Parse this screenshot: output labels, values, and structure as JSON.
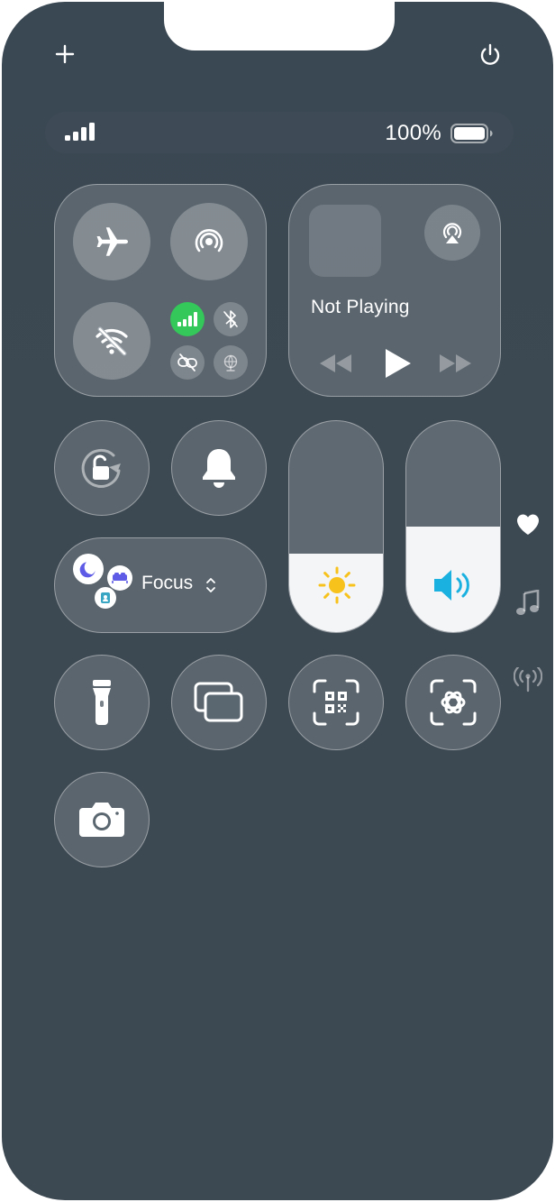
{
  "top_controls": {
    "add_icon": "plus-icon",
    "power_icon": "power-icon"
  },
  "status_bar": {
    "signal_icon": "cellular-signal-icon",
    "battery_percent": "100%",
    "battery_level": 1.0
  },
  "connectivity": {
    "airplane_mode": {
      "icon": "airplane-icon",
      "on": false
    },
    "airdrop": {
      "icon": "airdrop-icon",
      "on": false
    },
    "wifi": {
      "icon": "wifi-off-icon",
      "on": false
    },
    "cellular": {
      "icon": "cellular-data-icon",
      "on": true,
      "color": "#34c759"
    },
    "bluetooth": {
      "icon": "bluetooth-off-icon",
      "on": false
    },
    "personal_hotspot": {
      "icon": "link-off-icon",
      "on": false
    },
    "satellite": {
      "icon": "satellite-icon",
      "on": false
    }
  },
  "media": {
    "status": "Not Playing",
    "airplay_icon": "airplay-audio-icon",
    "controls": [
      "rewind-icon",
      "play-icon",
      "fast-forward-icon"
    ]
  },
  "controls": {
    "orientation_lock": "rotation-lock-icon",
    "silent_mode": "bell-icon",
    "focus_label": "Focus",
    "focus_icons": [
      "moon-icon",
      "bed-icon",
      "person-badge-icon"
    ],
    "brightness_level": 0.37,
    "volume_level": 0.5,
    "brightness_color": "#f8c21c",
    "volume_color": "#1ab0e0"
  },
  "bottom_controls": [
    "flashlight-icon",
    "screen-mirroring-icon",
    "qr-code-scanner-icon",
    "visual-intelligence-icon",
    "camera-icon"
  ],
  "side_indicators": [
    "heart-icon",
    "music-note-icon",
    "antenna-icon"
  ]
}
